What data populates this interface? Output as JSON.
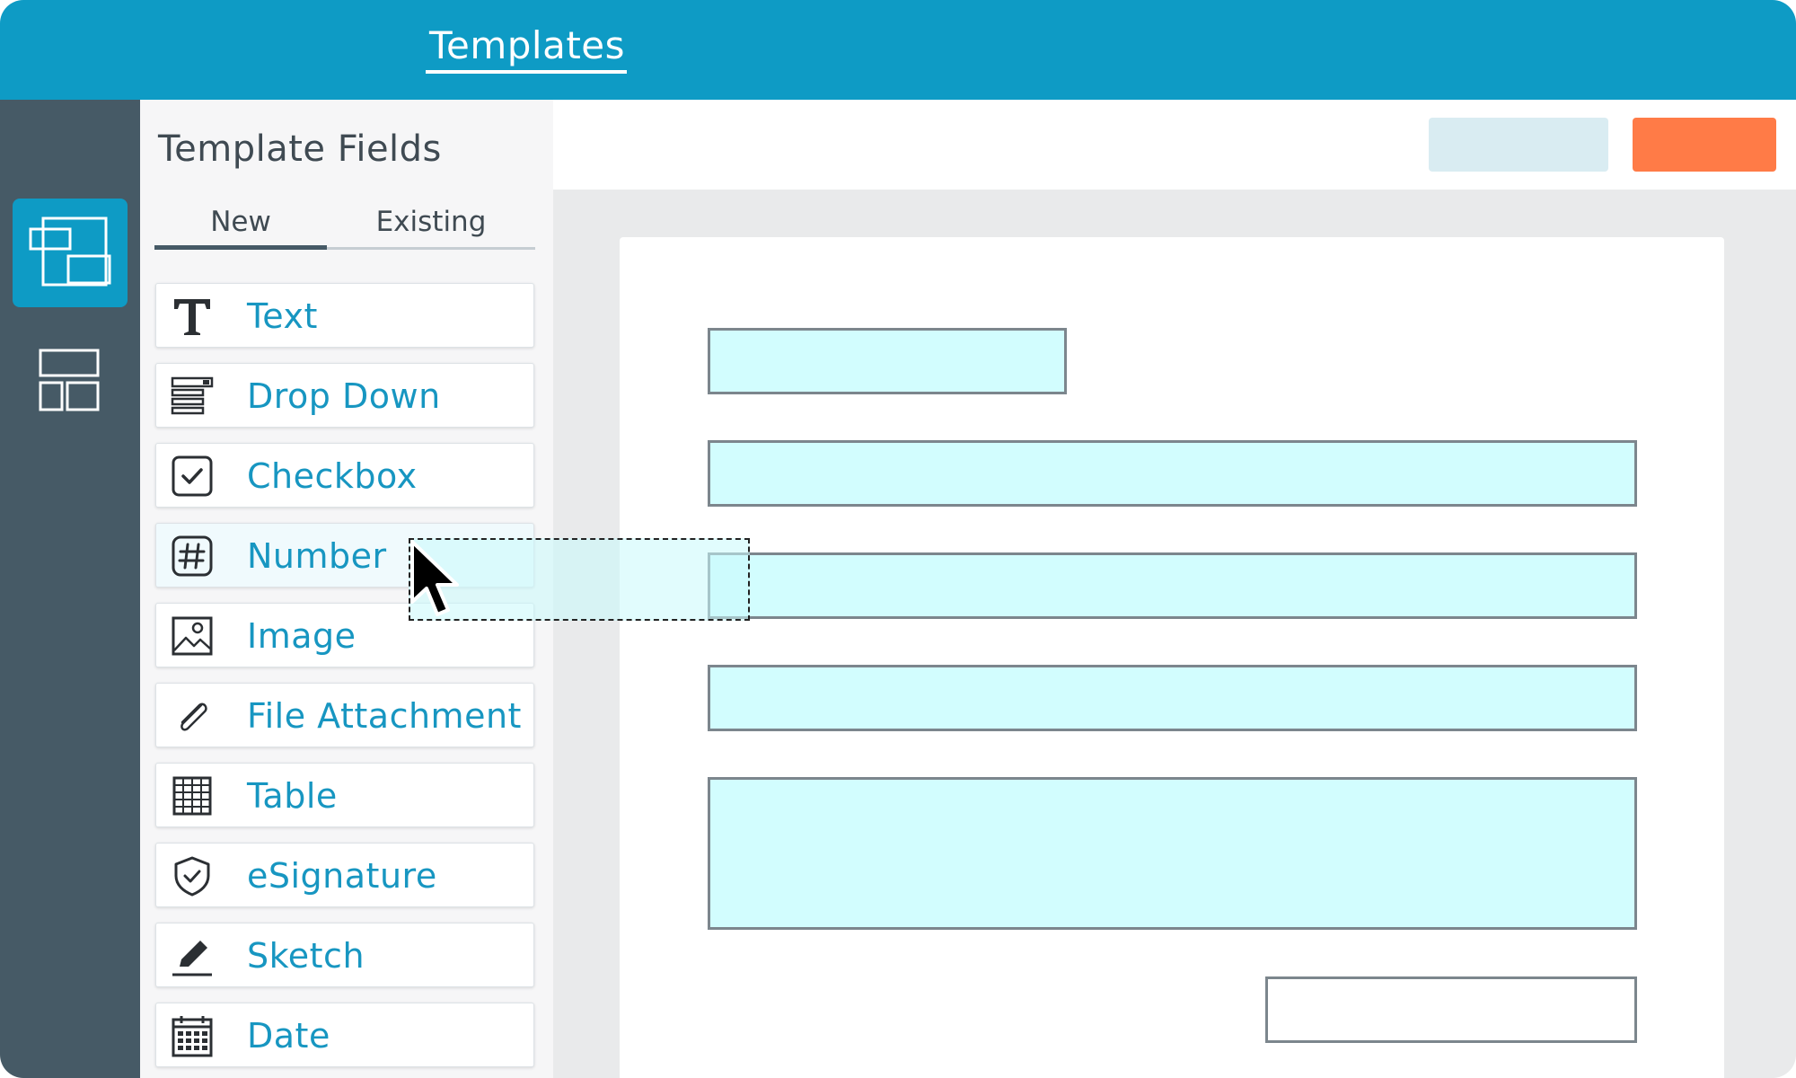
{
  "header": {
    "title": "Templates"
  },
  "rail": {
    "items": [
      {
        "icon": "overlapping-frames-icon",
        "active": true
      },
      {
        "icon": "layout-grid-icon",
        "active": false
      }
    ]
  },
  "panel": {
    "title": "Template Fields",
    "tabs": {
      "new": "New",
      "existing": "Existing",
      "active": "New"
    },
    "fields": [
      {
        "label": "Text",
        "icon": "text-t-icon"
      },
      {
        "label": "Drop Down",
        "icon": "dropdown-icon"
      },
      {
        "label": "Checkbox",
        "icon": "checkbox-icon"
      },
      {
        "label": "Number",
        "icon": "hash-icon",
        "state": "dragging"
      },
      {
        "label": "Image",
        "icon": "image-icon"
      },
      {
        "label": "File Attachment",
        "icon": "paperclip-icon"
      },
      {
        "label": "Table",
        "icon": "table-icon"
      },
      {
        "label": "eSignature",
        "icon": "shield-check-icon"
      },
      {
        "label": "Sketch",
        "icon": "pencil-icon"
      },
      {
        "label": "Date",
        "icon": "calendar-icon"
      }
    ]
  },
  "colors": {
    "header": "#0e9bc5",
    "rail": "#465a66",
    "accent_text": "#1796c1",
    "primary_button": "#ff7b47",
    "secondary_button": "#d9ecf2",
    "field_placeholder": "#d2fdfe"
  }
}
